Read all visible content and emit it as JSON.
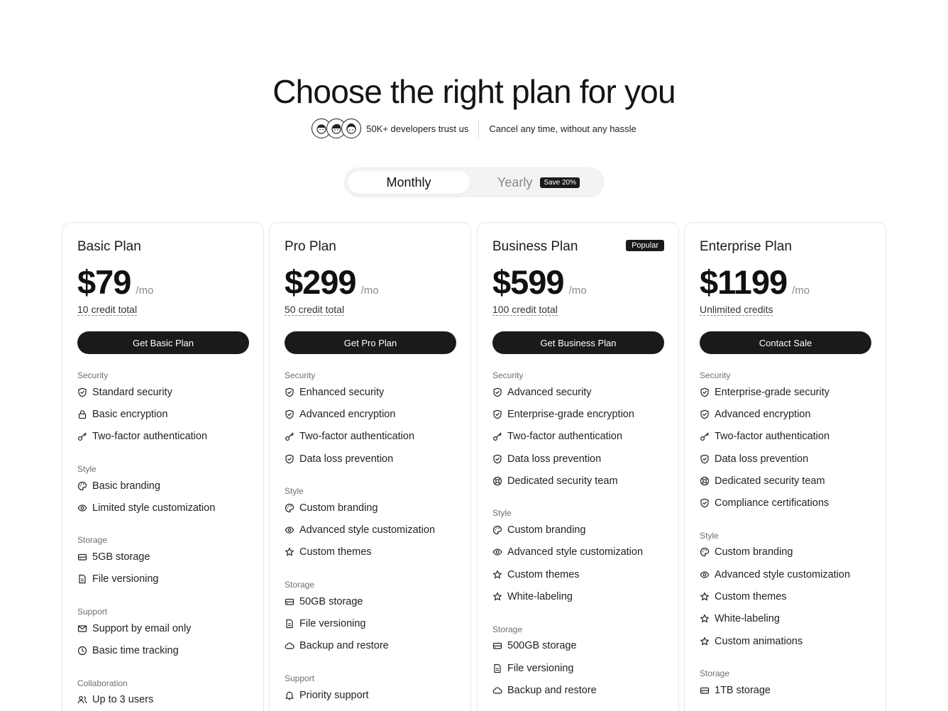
{
  "hero": {
    "title": "Choose the right plan for you",
    "trust_text": "50K+ developers trust us",
    "cancel_text": "Cancel any time, without any hassle"
  },
  "billing_toggle": {
    "monthly": "Monthly",
    "yearly": "Yearly",
    "save_badge": "Save 20%",
    "selected": "Monthly"
  },
  "plans": [
    {
      "name": "Basic Plan",
      "price": "$79",
      "per": "/mo",
      "credits": "10 credit total",
      "cta": "Get Basic Plan",
      "badge": "",
      "sections": [
        {
          "title": "Security",
          "features": [
            {
              "label": "Standard security",
              "icon": "shield"
            },
            {
              "label": "Basic encryption",
              "icon": "lock"
            },
            {
              "label": "Two-factor authentication",
              "icon": "key"
            }
          ]
        },
        {
          "title": "Style",
          "features": [
            {
              "label": "Basic branding",
              "icon": "palette"
            },
            {
              "label": "Limited style customization",
              "icon": "eye"
            }
          ]
        },
        {
          "title": "Storage",
          "features": [
            {
              "label": "5GB storage",
              "icon": "drive"
            },
            {
              "label": "File versioning",
              "icon": "file"
            }
          ]
        },
        {
          "title": "Support",
          "features": [
            {
              "label": "Support by email only",
              "icon": "mail"
            },
            {
              "label": "Basic time tracking",
              "icon": "clock"
            }
          ]
        },
        {
          "title": "Collaboration",
          "features": [
            {
              "label": "Up to 3 users",
              "icon": "users"
            }
          ]
        }
      ]
    },
    {
      "name": "Pro Plan",
      "price": "$299",
      "per": "/mo",
      "credits": "50 credit total",
      "cta": "Get Pro Plan",
      "badge": "",
      "sections": [
        {
          "title": "Security",
          "features": [
            {
              "label": "Enhanced security",
              "icon": "shield"
            },
            {
              "label": "Advanced encryption",
              "icon": "shield"
            },
            {
              "label": "Two-factor authentication",
              "icon": "key"
            },
            {
              "label": "Data loss prevention",
              "icon": "shield"
            }
          ]
        },
        {
          "title": "Style",
          "features": [
            {
              "label": "Custom branding",
              "icon": "palette"
            },
            {
              "label": "Advanced style customization",
              "icon": "eye"
            },
            {
              "label": "Custom themes",
              "icon": "star"
            }
          ]
        },
        {
          "title": "Storage",
          "features": [
            {
              "label": "50GB storage",
              "icon": "drive"
            },
            {
              "label": "File versioning",
              "icon": "file"
            },
            {
              "label": "Backup and restore",
              "icon": "cloud"
            }
          ]
        },
        {
          "title": "Support",
          "features": [
            {
              "label": "Priority support",
              "icon": "bell"
            }
          ]
        }
      ]
    },
    {
      "name": "Business Plan",
      "price": "$599",
      "per": "/mo",
      "credits": "100 credit total",
      "cta": "Get Business Plan",
      "badge": "Popular",
      "sections": [
        {
          "title": "Security",
          "features": [
            {
              "label": "Advanced security",
              "icon": "shield"
            },
            {
              "label": "Enterprise-grade encryption",
              "icon": "shield"
            },
            {
              "label": "Two-factor authentication",
              "icon": "key"
            },
            {
              "label": "Data loss prevention",
              "icon": "shield"
            },
            {
              "label": "Dedicated security team",
              "icon": "lifebuoy"
            }
          ]
        },
        {
          "title": "Style",
          "features": [
            {
              "label": "Custom branding",
              "icon": "palette"
            },
            {
              "label": "Advanced style customization",
              "icon": "eye"
            },
            {
              "label": "Custom themes",
              "icon": "star"
            },
            {
              "label": "White-labeling",
              "icon": "star"
            }
          ]
        },
        {
          "title": "Storage",
          "features": [
            {
              "label": "500GB storage",
              "icon": "drive"
            },
            {
              "label": "File versioning",
              "icon": "file"
            },
            {
              "label": "Backup and restore",
              "icon": "cloud"
            }
          ]
        }
      ]
    },
    {
      "name": "Enterprise Plan",
      "price": "$1199",
      "per": "/mo",
      "credits": "Unlimited credits",
      "cta": "Contact Sale",
      "badge": "",
      "sections": [
        {
          "title": "Security",
          "features": [
            {
              "label": "Enterprise-grade security",
              "icon": "shield"
            },
            {
              "label": "Advanced encryption",
              "icon": "shield"
            },
            {
              "label": "Two-factor authentication",
              "icon": "key"
            },
            {
              "label": "Data loss prevention",
              "icon": "shield"
            },
            {
              "label": "Dedicated security team",
              "icon": "lifebuoy"
            },
            {
              "label": "Compliance certifications",
              "icon": "shield"
            }
          ]
        },
        {
          "title": "Style",
          "features": [
            {
              "label": "Custom branding",
              "icon": "palette"
            },
            {
              "label": "Advanced style customization",
              "icon": "eye"
            },
            {
              "label": "Custom themes",
              "icon": "star"
            },
            {
              "label": "White-labeling",
              "icon": "star"
            },
            {
              "label": "Custom animations",
              "icon": "star"
            }
          ]
        },
        {
          "title": "Storage",
          "features": [
            {
              "label": "1TB storage",
              "icon": "drive"
            }
          ]
        }
      ]
    }
  ]
}
